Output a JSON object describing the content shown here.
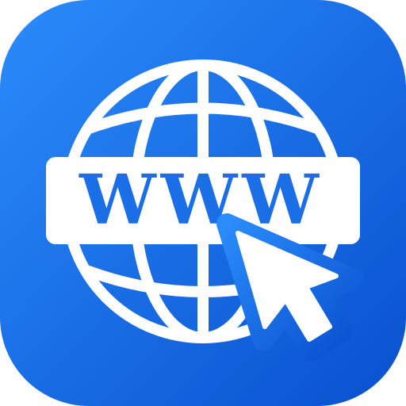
{
  "icon": {
    "name": "www-globe-cursor-icon",
    "label": "WWW"
  },
  "colors": {
    "gradient_start": "#2b8cfb",
    "gradient_end": "#0950cf",
    "foreground": "#ffffff",
    "text": "#1b6fe6"
  }
}
